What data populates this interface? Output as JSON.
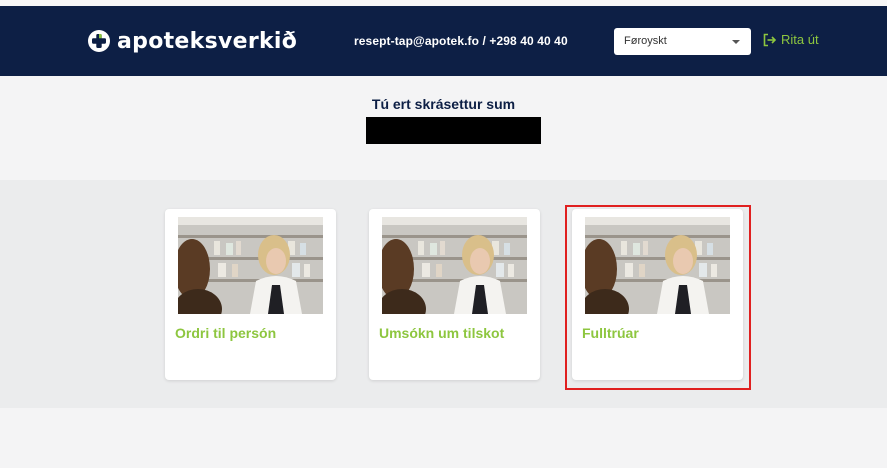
{
  "header": {
    "brand": "apoteksverkið",
    "contact": "resept-tap@apotek.fo / +298 40 40 40",
    "language": {
      "selected": "Føroyskt"
    },
    "logout_label": "Rita út"
  },
  "login": {
    "title": "Tú ert skrásettur sum",
    "name": ""
  },
  "cards": [
    {
      "label": "Ordri til persón"
    },
    {
      "label": "Umsókn um tilskot"
    },
    {
      "label": "Fulltrúar"
    }
  ],
  "colors": {
    "header_bg": "#0d1f45",
    "accent_green": "#8dc63f",
    "highlight_red": "#e02020"
  },
  "icons": {
    "logo": "pharmacy-cross-icon",
    "logout": "logout-arrow-icon",
    "dropdown": "chevron-down-icon"
  }
}
